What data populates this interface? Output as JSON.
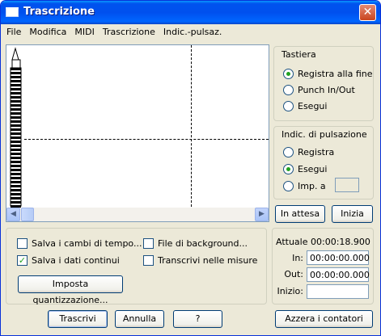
{
  "window": {
    "title": "Trascrizione"
  },
  "menu": [
    "File",
    "Modifica",
    "MIDI",
    "Trascrizione",
    "Indic.-pulsaz."
  ],
  "tastiera": {
    "title": "Tastiera",
    "options": [
      "Registra alla fine",
      "Punch In/Out",
      "Esegui"
    ],
    "selected_index": 0
  },
  "pulsazione": {
    "title": "Indic. di pulsazione",
    "options": [
      "Registra",
      "Esegui",
      "Imp. a"
    ],
    "selected_index": 1
  },
  "buttons": {
    "in_attesa": "In attesa",
    "inizia": "Inizia",
    "imposta_quant": "Imposta quantizzazione...",
    "trascrivi": "Trascrivi",
    "annulla": "Annulla",
    "help": "?",
    "azzera": "Azzera i contatori"
  },
  "checkboxes": [
    {
      "label": "Salva i cambi di tempo...",
      "checked": false
    },
    {
      "label": "File di background...",
      "checked": false
    },
    {
      "label": "Salva i dati continui",
      "checked": true
    },
    {
      "label": "Transcrivi nelle misure",
      "checked": false
    }
  ],
  "counters": {
    "attuale_label": "Attuale",
    "attuale_value": "00:00:18.900",
    "in_label": "In:",
    "in_value": "00:00:00.000",
    "out_label": "Out:",
    "out_value": "00:00:00.000",
    "inizio_label": "Inizio:",
    "inizio_value": ""
  },
  "icons": {
    "close": "close-icon",
    "window": "window-icon",
    "scroll_left": "arrow-left-icon",
    "scroll_right": "arrow-right-icon"
  }
}
